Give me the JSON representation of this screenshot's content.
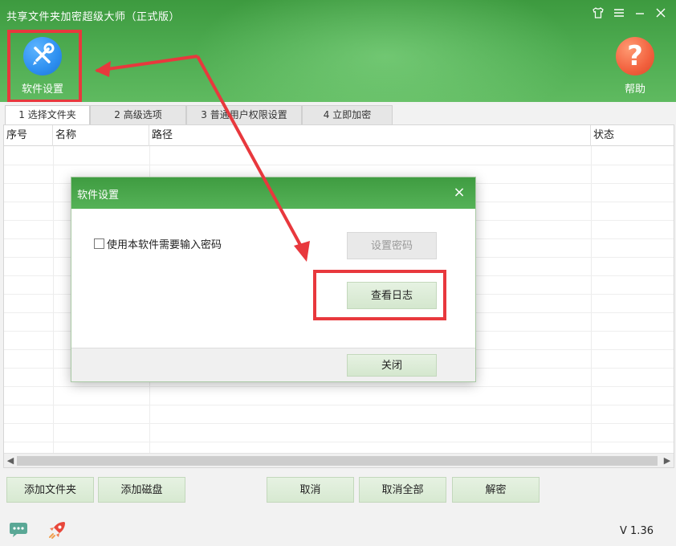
{
  "window": {
    "title": "共享文件夹加密超级大师（正式版）",
    "controls": [
      "shirt-icon",
      "menu-icon",
      "minimize-icon",
      "close-icon"
    ]
  },
  "toolbar": {
    "settings_label": "软件设置",
    "help_label": "帮助",
    "help_glyph": "?"
  },
  "tabs": [
    {
      "label": "1 选择文件夹",
      "active": true
    },
    {
      "label": "2 高级选项",
      "active": false
    },
    {
      "label": "3 普通用户权限设置",
      "active": false
    },
    {
      "label": "4 立即加密",
      "active": false
    }
  ],
  "table": {
    "columns": [
      "序号",
      "名称",
      "路径",
      "状态"
    ],
    "rows": []
  },
  "actions": {
    "add_folder": "添加文件夹",
    "add_disk": "添加磁盘",
    "cancel": "取消",
    "cancel_all": "取消全部",
    "decrypt": "解密"
  },
  "footer": {
    "version": "V 1.36"
  },
  "dialog": {
    "title": "软件设置",
    "close_glyph": "×",
    "require_password_label": "使用本软件需要输入密码",
    "require_password_checked": false,
    "set_password": "设置密码",
    "view_log": "查看日志",
    "close_button": "关闭"
  },
  "colors": {
    "header_green": "#4caa4f",
    "accent_red": "#e8383d",
    "settings_blue": "#2d8ff0",
    "help_orange": "#f2613e"
  }
}
